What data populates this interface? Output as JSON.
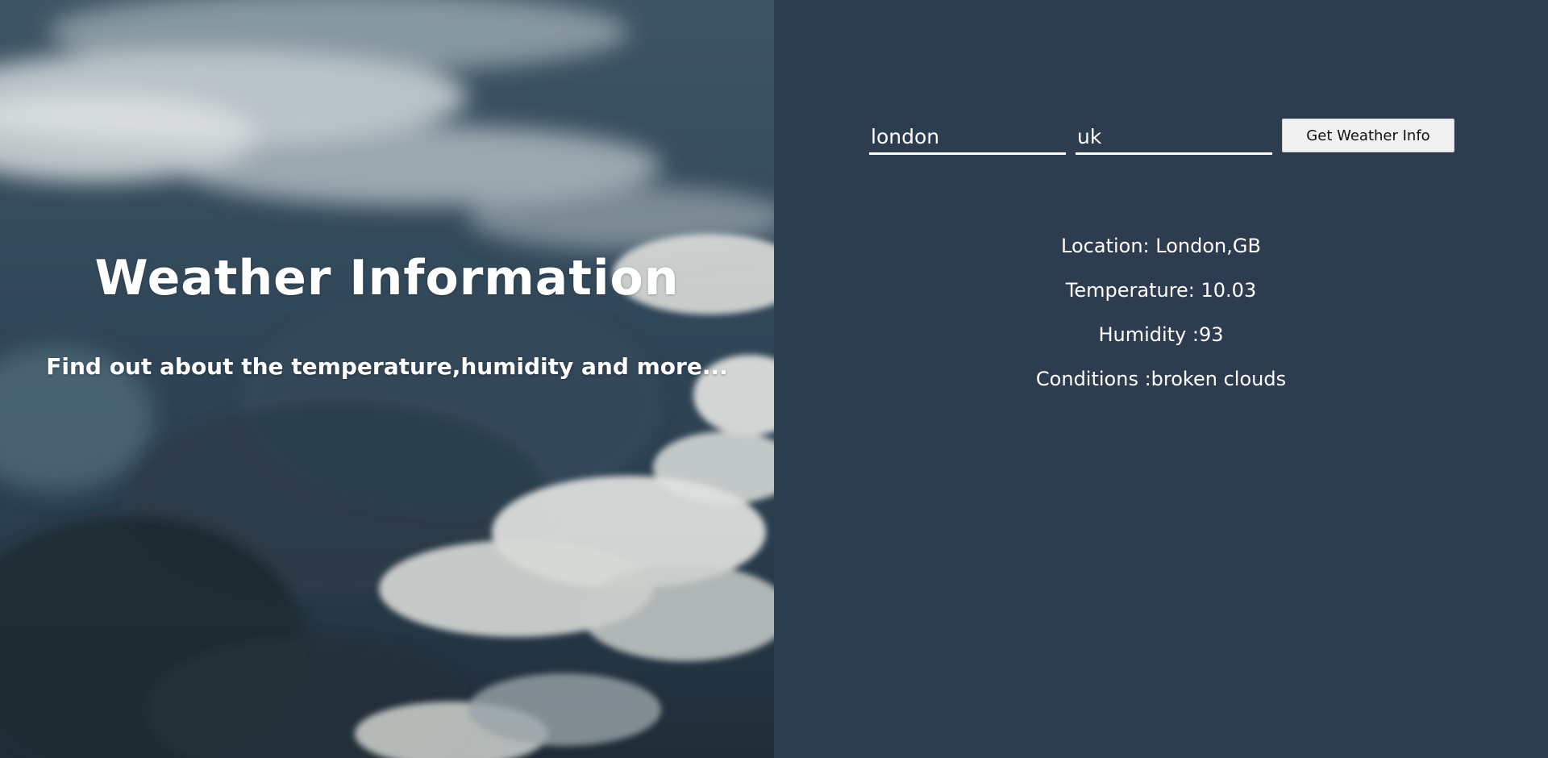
{
  "hero": {
    "title": "Weather Information",
    "subtitle": "Find out about the temperature,humidity and more..."
  },
  "form": {
    "city_value": "london",
    "country_value": "uk",
    "submit_label": "Get Weather Info"
  },
  "results": {
    "location": "Location: London,GB",
    "temperature": "Temperature: 10.03",
    "humidity": "Humidity :93",
    "conditions": "Conditions :broken clouds"
  },
  "colors": {
    "panel_background": "#2e3c4f",
    "button_background": "#f1f1f1",
    "text": "#ffffff"
  }
}
